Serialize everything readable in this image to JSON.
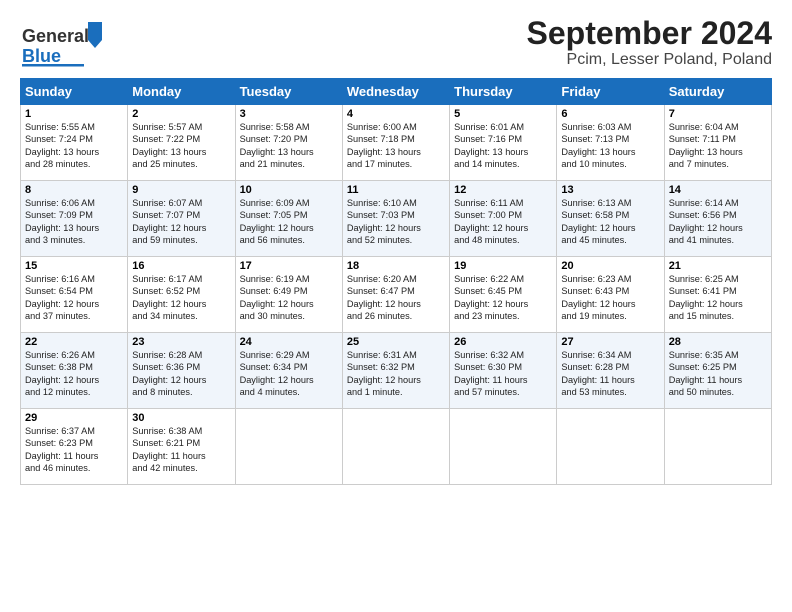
{
  "header": {
    "title": "September 2024",
    "subtitle": "Pcim, Lesser Poland, Poland"
  },
  "logo": {
    "line1": "General",
    "line2": "Blue"
  },
  "days_of_week": [
    "Sunday",
    "Monday",
    "Tuesday",
    "Wednesday",
    "Thursday",
    "Friday",
    "Saturday"
  ],
  "weeks": [
    [
      {
        "num": "1",
        "info": "Sunrise: 5:55 AM\nSunset: 7:24 PM\nDaylight: 13 hours\nand 28 minutes."
      },
      {
        "num": "2",
        "info": "Sunrise: 5:57 AM\nSunset: 7:22 PM\nDaylight: 13 hours\nand 25 minutes."
      },
      {
        "num": "3",
        "info": "Sunrise: 5:58 AM\nSunset: 7:20 PM\nDaylight: 13 hours\nand 21 minutes."
      },
      {
        "num": "4",
        "info": "Sunrise: 6:00 AM\nSunset: 7:18 PM\nDaylight: 13 hours\nand 17 minutes."
      },
      {
        "num": "5",
        "info": "Sunrise: 6:01 AM\nSunset: 7:16 PM\nDaylight: 13 hours\nand 14 minutes."
      },
      {
        "num": "6",
        "info": "Sunrise: 6:03 AM\nSunset: 7:13 PM\nDaylight: 13 hours\nand 10 minutes."
      },
      {
        "num": "7",
        "info": "Sunrise: 6:04 AM\nSunset: 7:11 PM\nDaylight: 13 hours\nand 7 minutes."
      }
    ],
    [
      {
        "num": "8",
        "info": "Sunrise: 6:06 AM\nSunset: 7:09 PM\nDaylight: 13 hours\nand 3 minutes."
      },
      {
        "num": "9",
        "info": "Sunrise: 6:07 AM\nSunset: 7:07 PM\nDaylight: 12 hours\nand 59 minutes."
      },
      {
        "num": "10",
        "info": "Sunrise: 6:09 AM\nSunset: 7:05 PM\nDaylight: 12 hours\nand 56 minutes."
      },
      {
        "num": "11",
        "info": "Sunrise: 6:10 AM\nSunset: 7:03 PM\nDaylight: 12 hours\nand 52 minutes."
      },
      {
        "num": "12",
        "info": "Sunrise: 6:11 AM\nSunset: 7:00 PM\nDaylight: 12 hours\nand 48 minutes."
      },
      {
        "num": "13",
        "info": "Sunrise: 6:13 AM\nSunset: 6:58 PM\nDaylight: 12 hours\nand 45 minutes."
      },
      {
        "num": "14",
        "info": "Sunrise: 6:14 AM\nSunset: 6:56 PM\nDaylight: 12 hours\nand 41 minutes."
      }
    ],
    [
      {
        "num": "15",
        "info": "Sunrise: 6:16 AM\nSunset: 6:54 PM\nDaylight: 12 hours\nand 37 minutes."
      },
      {
        "num": "16",
        "info": "Sunrise: 6:17 AM\nSunset: 6:52 PM\nDaylight: 12 hours\nand 34 minutes."
      },
      {
        "num": "17",
        "info": "Sunrise: 6:19 AM\nSunset: 6:49 PM\nDaylight: 12 hours\nand 30 minutes."
      },
      {
        "num": "18",
        "info": "Sunrise: 6:20 AM\nSunset: 6:47 PM\nDaylight: 12 hours\nand 26 minutes."
      },
      {
        "num": "19",
        "info": "Sunrise: 6:22 AM\nSunset: 6:45 PM\nDaylight: 12 hours\nand 23 minutes."
      },
      {
        "num": "20",
        "info": "Sunrise: 6:23 AM\nSunset: 6:43 PM\nDaylight: 12 hours\nand 19 minutes."
      },
      {
        "num": "21",
        "info": "Sunrise: 6:25 AM\nSunset: 6:41 PM\nDaylight: 12 hours\nand 15 minutes."
      }
    ],
    [
      {
        "num": "22",
        "info": "Sunrise: 6:26 AM\nSunset: 6:38 PM\nDaylight: 12 hours\nand 12 minutes."
      },
      {
        "num": "23",
        "info": "Sunrise: 6:28 AM\nSunset: 6:36 PM\nDaylight: 12 hours\nand 8 minutes."
      },
      {
        "num": "24",
        "info": "Sunrise: 6:29 AM\nSunset: 6:34 PM\nDaylight: 12 hours\nand 4 minutes."
      },
      {
        "num": "25",
        "info": "Sunrise: 6:31 AM\nSunset: 6:32 PM\nDaylight: 12 hours\nand 1 minute."
      },
      {
        "num": "26",
        "info": "Sunrise: 6:32 AM\nSunset: 6:30 PM\nDaylight: 11 hours\nand 57 minutes."
      },
      {
        "num": "27",
        "info": "Sunrise: 6:34 AM\nSunset: 6:28 PM\nDaylight: 11 hours\nand 53 minutes."
      },
      {
        "num": "28",
        "info": "Sunrise: 6:35 AM\nSunset: 6:25 PM\nDaylight: 11 hours\nand 50 minutes."
      }
    ],
    [
      {
        "num": "29",
        "info": "Sunrise: 6:37 AM\nSunset: 6:23 PM\nDaylight: 11 hours\nand 46 minutes."
      },
      {
        "num": "30",
        "info": "Sunrise: 6:38 AM\nSunset: 6:21 PM\nDaylight: 11 hours\nand 42 minutes."
      },
      null,
      null,
      null,
      null,
      null
    ]
  ]
}
